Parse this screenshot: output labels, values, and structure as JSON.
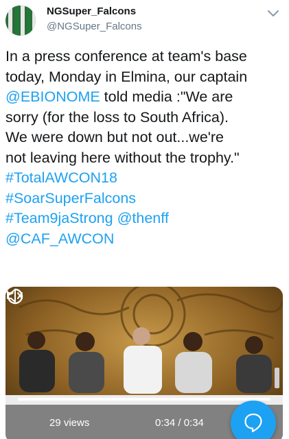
{
  "tweet": {
    "author_name": "NGSuper_Falcons",
    "author_handle": "@NGSuper_Falcons",
    "text_lines": [
      [
        {
          "t": "In a press conference at team's base",
          "link": false
        }
      ],
      [
        {
          "t": "today, Monday in Elmina, our captain",
          "link": false
        }
      ],
      [
        {
          "t": "@EBIONOME",
          "link": true
        },
        {
          "t": " told media :\"We are",
          "link": false
        }
      ],
      [
        {
          "t": "sorry (for the loss to South Africa).",
          "link": false
        }
      ],
      [
        {
          "t": "We were down but not out...we're",
          "link": false
        }
      ],
      [
        {
          "t": "not leaving here without the trophy.\"",
          "link": false
        }
      ],
      [
        {
          "t": "#TotalAWCON18",
          "link": true
        }
      ],
      [
        {
          "t": "#SoarSuperFalcons",
          "link": true
        }
      ],
      [
        {
          "t": "#Team9jaStrong",
          "link": true
        },
        {
          "t": " ",
          "link": false
        },
        {
          "t": "@thenff",
          "link": true
        }
      ],
      [
        {
          "t": "@CAF_AWCON",
          "link": true
        }
      ]
    ]
  },
  "video": {
    "views": "29 views",
    "time": "0:34 / 0:34",
    "progress": 1.0
  },
  "icons": {
    "caret": "chevron-down-icon",
    "replay": "replay-icon",
    "mute": "mute-icon",
    "compose": "compose-reply-icon"
  },
  "colors": {
    "link": "#1da1f2",
    "fab": "#1da1f2"
  }
}
